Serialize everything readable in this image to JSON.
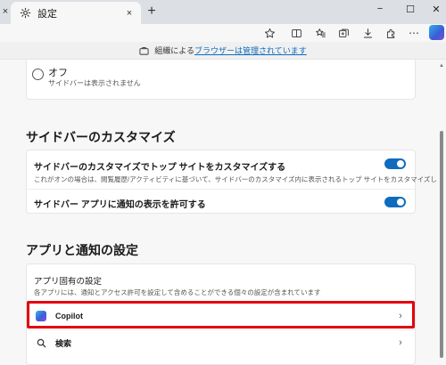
{
  "browser": {
    "tab_title": "設定",
    "new_tab_label": "+",
    "edge_close_label": "×",
    "tab_close_label": "×"
  },
  "window": {
    "minimize": "−",
    "maximize": "☐",
    "close": "✕"
  },
  "toolbar": {
    "more_label": "⋯"
  },
  "managed_bar": {
    "prefix": "組織による",
    "link": "ブラウザーは管理されています"
  },
  "top_card": {
    "option_title": "オフ",
    "option_desc": "サイドバーは表示されません"
  },
  "sidebar_section": {
    "title": "サイドバーのカスタマイズ",
    "items": [
      {
        "title": "サイドバーのカスタマイズでトップ サイトをカスタマイズする",
        "desc": "これがオンの場合は、閲覧履歴/アクティビティに基づいて、サイドバーのカスタマイズ内に表示されるトップ サイトをカスタマイズします",
        "enabled": true
      },
      {
        "title": "サイドバー アプリに通知の表示を許可する",
        "enabled": true
      }
    ]
  },
  "apps_section": {
    "title": "アプリと通知の設定",
    "card_title": "アプリ固有の設定",
    "card_desc": "各アプリには、通知とアクセス許可を設定して含めることができる個々の設定が含まれています",
    "rows": [
      {
        "label": "Copilot",
        "icon": "copilot-icon"
      },
      {
        "label": "検索",
        "icon": "search-icon"
      }
    ],
    "chevron": "›"
  },
  "colors": {
    "accent": "#0f6cbd",
    "highlight": "#e3000f"
  }
}
